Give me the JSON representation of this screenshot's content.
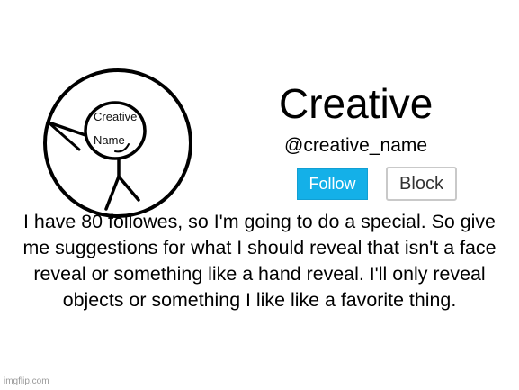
{
  "avatar": {
    "label_line1": "Creative",
    "label_line2": "Name"
  },
  "profile": {
    "display_name": "Creative",
    "handle": "@creative_name"
  },
  "actions": {
    "follow_label": "Follow",
    "block_label": "Block"
  },
  "post": {
    "message": "I have 80 followes, so I'm going to do a special. So give me suggestions for what I should reveal that isn't a face reveal or something like a hand reveal. I'll only reveal objects or something I like like a favorite thing."
  },
  "watermark": "imgflip.com",
  "colors": {
    "follow_button": "#14b0e8",
    "background": "#ffffff"
  }
}
